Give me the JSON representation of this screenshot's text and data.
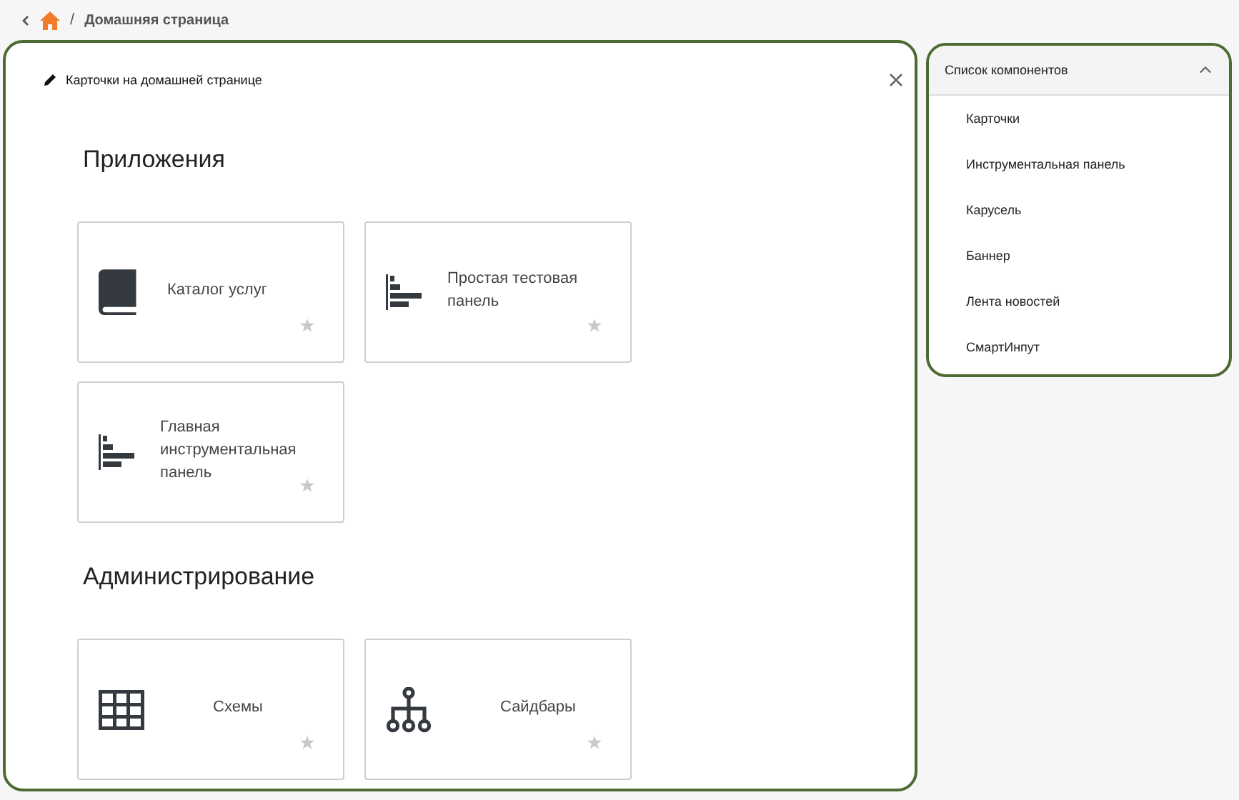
{
  "breadcrumb": {
    "separator": "/",
    "current": "Домашняя страница"
  },
  "editor": {
    "title": "Карточки на домашней странице",
    "sections": [
      {
        "title": "Приложения",
        "cards": [
          {
            "kind": "book",
            "label": "Каталог услуг"
          },
          {
            "kind": "chart",
            "label": "Простая тестовая панель"
          },
          {
            "kind": "chart",
            "label": "Главная инструментальная панель"
          }
        ]
      },
      {
        "title": "Администрирование",
        "cards": [
          {
            "kind": "table",
            "label": "Схемы"
          },
          {
            "kind": "tree",
            "label": "Сайдбары"
          }
        ]
      }
    ]
  },
  "components": {
    "title": "Список компонентов",
    "expanded": true,
    "items": [
      "Карточки",
      "Инструментальная панель",
      "Карусель",
      "Баннер",
      "Лента новостей",
      "СмартИнпут"
    ]
  }
}
